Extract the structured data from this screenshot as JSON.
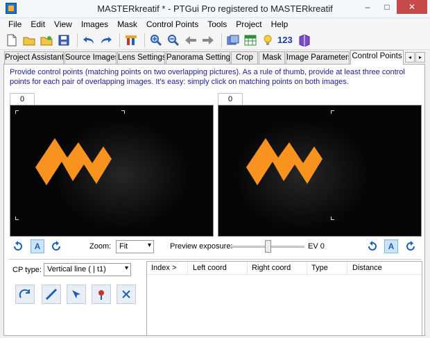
{
  "window": {
    "title": "MASTERkreatif * - PTGui Pro registered to MASTERkreatif",
    "minimize": "–",
    "maximize": "□",
    "close": "✕"
  },
  "menu": [
    "File",
    "Edit",
    "View",
    "Images",
    "Mask",
    "Control Points",
    "Tools",
    "Project",
    "Help"
  ],
  "toolbar": {
    "icons": [
      "new-file-icon",
      "open-folder-icon",
      "open-recent-icon",
      "save-icon",
      "undo-icon",
      "redo-icon",
      "tools-icon",
      "zoom-in-icon",
      "zoom-out-icon",
      "arrow-left-icon",
      "arrow-right-icon",
      "panorama-editor-icon",
      "control-point-table-icon",
      "lightbulb-icon",
      "numbering-text",
      "book-icon"
    ],
    "numbering": "123"
  },
  "tabs": [
    "Project Assistant",
    "Source Images",
    "Lens Settings",
    "Panorama Settings",
    "Crop",
    "Mask",
    "Image Parameters",
    "Control Points"
  ],
  "tab_scroll": {
    "left": "◂",
    "right": "▸"
  },
  "description": "Provide control points (matching points on two overlapping pictures). As a rule of thumb, provide at least three control points for each pair of overlapping images. It's easy: simply click on matching points on both images.",
  "left_pane": {
    "image_tab": "0",
    "auto_label": "A"
  },
  "right_pane": {
    "image_tab": "0",
    "auto_label": "A"
  },
  "zoom": {
    "label": "Zoom:",
    "value": "Fit"
  },
  "preview": {
    "label": "Preview exposure:",
    "ev_label": "EV 0",
    "slider_position": 0.5
  },
  "cp_type": {
    "label": "CP type:",
    "value": "Vertical line   ( | t1)"
  },
  "cp_table": {
    "columns": [
      "Index >",
      "Left coord",
      "Right coord",
      "Type",
      "Distance"
    ],
    "rows": []
  },
  "colors": {
    "logo": "#f7931e",
    "accent": "#1d5fb3"
  }
}
